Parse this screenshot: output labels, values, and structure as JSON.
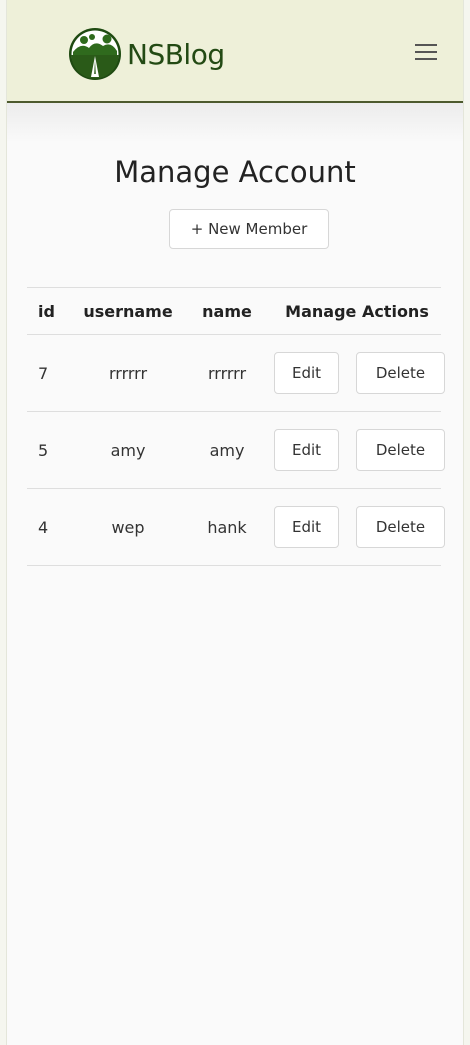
{
  "navbar": {
    "brand": "NSBlog",
    "logo_icon": "landscape-logo-icon",
    "menu_icon": "hamburger-menu-icon"
  },
  "page": {
    "title": "Manage Account",
    "new_member_label": "+ New Member"
  },
  "table": {
    "headers": {
      "id": "id",
      "username": "username",
      "name": "name",
      "actions": "Manage Actions"
    },
    "rows": [
      {
        "id": "7",
        "username": "rrrrrr",
        "name": "rrrrrr",
        "edit": "Edit",
        "delete": "Delete"
      },
      {
        "id": "5",
        "username": "amy",
        "name": "amy",
        "edit": "Edit",
        "delete": "Delete"
      },
      {
        "id": "4",
        "username": "wep",
        "name": "hank",
        "edit": "Edit",
        "delete": "Delete"
      }
    ]
  },
  "colors": {
    "navbar_bg": "#eef0d9",
    "brand_green": "#234a14",
    "navbar_border": "#4d5a2e"
  }
}
